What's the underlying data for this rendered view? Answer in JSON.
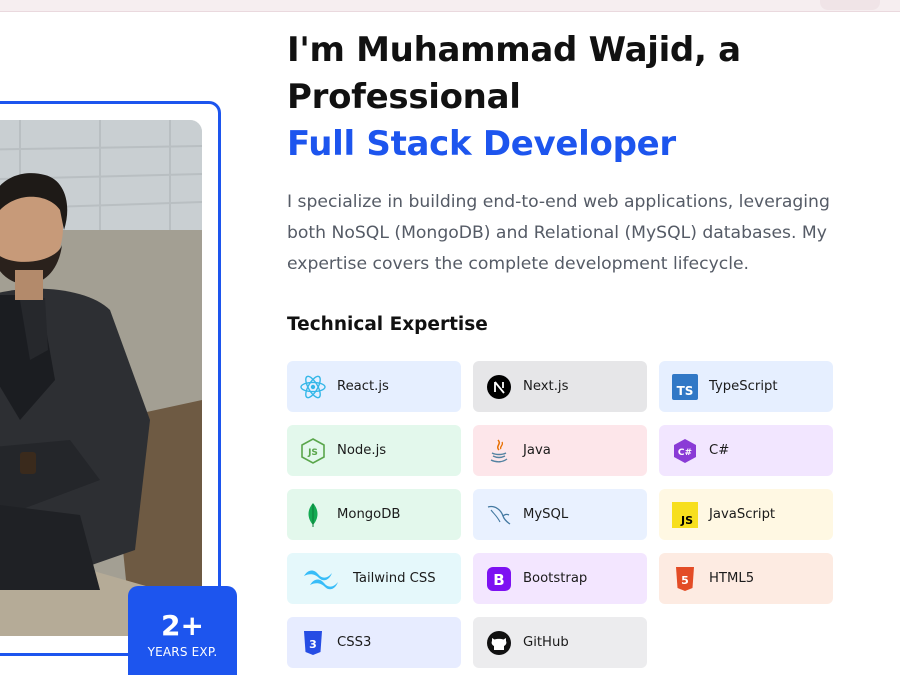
{
  "headline": {
    "line1": "I'm Muhammad Wajid, a",
    "line2": "Professional",
    "accent": "Full Stack Developer"
  },
  "intro": "I specialize in building end-to-end web applications, leveraging both NoSQL (MongoDB) and Relational (MySQL) databases. My expertise covers the complete development lifecycle.",
  "experience_badge": {
    "value": "2+",
    "label": "YEARS EXP."
  },
  "skills_section": {
    "title": "Technical Expertise",
    "skills": [
      {
        "label": "React.js",
        "icon": "react-icon",
        "bg": "#e6efff"
      },
      {
        "label": "Next.js",
        "icon": "nextjs-icon",
        "bg": "#e6e6e8"
      },
      {
        "label": "TypeScript",
        "icon": "typescript-icon",
        "bg": "#e6efff"
      },
      {
        "label": "Node.js",
        "icon": "nodejs-icon",
        "bg": "#e3f8ec"
      },
      {
        "label": "Java",
        "icon": "java-icon",
        "bg": "#fde6ea"
      },
      {
        "label": "C#",
        "icon": "csharp-icon",
        "bg": "#f2e6ff"
      },
      {
        "label": "MongoDB",
        "icon": "mongodb-icon",
        "bg": "#e3f8ec"
      },
      {
        "label": "MySQL",
        "icon": "mysql-icon",
        "bg": "#e9f1ff"
      },
      {
        "label": "JavaScript",
        "icon": "javascript-icon",
        "bg": "#fff8e3"
      },
      {
        "label": "Tailwind CSS",
        "icon": "tailwind-icon",
        "bg": "#e5f8fb"
      },
      {
        "label": "Bootstrap",
        "icon": "bootstrap-icon",
        "bg": "#f3e6ff"
      },
      {
        "label": "HTML5",
        "icon": "html5-icon",
        "bg": "#fdebe2"
      },
      {
        "label": "CSS3",
        "icon": "css3-icon",
        "bg": "#e7ecff"
      },
      {
        "label": "GitHub",
        "icon": "github-icon",
        "bg": "#ececee"
      }
    ]
  },
  "colors": {
    "accent": "#1d55ee",
    "text": "#111111",
    "muted": "#555b66"
  }
}
